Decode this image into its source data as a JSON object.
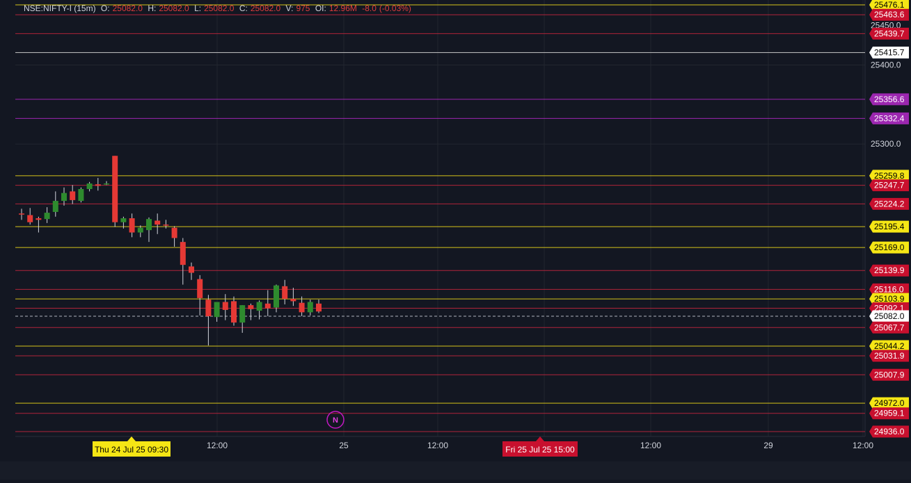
{
  "header": {
    "symbol": "NSE:NIFTY-I (15m)",
    "o_label": "O:",
    "o_val": "25082.0",
    "h_label": "H:",
    "h_val": "25082.0",
    "l_label": "L:",
    "l_val": "25082.0",
    "c_label": "C:",
    "c_val": "25082.0",
    "v_label": "V:",
    "v_val": "975",
    "oi_label": "OI:",
    "oi_val": "12.96M",
    "change": "-8.0",
    "change_pct": "(-0.03%)"
  },
  "colors": {
    "background": "#131722",
    "grid": "#22262f",
    "up": "#26a69a",
    "up_body": "#2e8b2e",
    "down": "#e53935",
    "yellow_line": "#d4c31a",
    "red_line": "#b0243a",
    "purple_line": "#9c27b0",
    "white_line": "#c8c8c8",
    "last_price_line": "#b2b5be",
    "text": "#d1d4dc"
  },
  "chart_data": {
    "type": "candlestick",
    "symbol": "NSE:NIFTY-I",
    "interval": "15m",
    "ylim": [
      24920,
      25480
    ],
    "y_ticks": [
      25300.0,
      25400.0
    ],
    "x_ticks": [
      "12:00",
      "25",
      "12:00",
      "12:00",
      "29",
      "12:00"
    ],
    "candles": [
      {
        "o": 25212,
        "h": 25218,
        "l": 25204,
        "c": 25211
      },
      {
        "o": 25210,
        "h": 25219,
        "l": 25198,
        "c": 25201
      },
      {
        "o": 25206,
        "h": 25208,
        "l": 25188,
        "c": 25204
      },
      {
        "o": 25205,
        "h": 25220,
        "l": 25200,
        "c": 25213
      },
      {
        "o": 25214,
        "h": 25240,
        "l": 25208,
        "c": 25228
      },
      {
        "o": 25228,
        "h": 25245,
        "l": 25222,
        "c": 25238
      },
      {
        "o": 25240,
        "h": 25248,
        "l": 25224,
        "c": 25229
      },
      {
        "o": 25228,
        "h": 25245,
        "l": 25226,
        "c": 25243
      },
      {
        "o": 25243,
        "h": 25252,
        "l": 25240,
        "c": 25250
      },
      {
        "o": 25249,
        "h": 25257,
        "l": 25241,
        "c": 25247
      },
      {
        "o": 25249,
        "h": 25253,
        "l": 25248,
        "c": 25250
      },
      {
        "o": 25285,
        "h": 25285,
        "l": 25195,
        "c": 25201
      },
      {
        "o": 25201,
        "h": 25208,
        "l": 25193,
        "c": 25206
      },
      {
        "o": 25206,
        "h": 25212,
        "l": 25182,
        "c": 25188
      },
      {
        "o": 25188,
        "h": 25197,
        "l": 25182,
        "c": 25194
      },
      {
        "o": 25191,
        "h": 25207,
        "l": 25176,
        "c": 25205
      },
      {
        "o": 25203,
        "h": 25212,
        "l": 25186,
        "c": 25198
      },
      {
        "o": 25198,
        "h": 25204,
        "l": 25193,
        "c": 25197
      },
      {
        "o": 25194,
        "h": 25196,
        "l": 25170,
        "c": 25181
      },
      {
        "o": 25176,
        "h": 25181,
        "l": 25122,
        "c": 25147
      },
      {
        "o": 25145,
        "h": 25150,
        "l": 25128,
        "c": 25137
      },
      {
        "o": 25129,
        "h": 25134,
        "l": 25083,
        "c": 25105
      },
      {
        "o": 25103,
        "h": 25109,
        "l": 25045,
        "c": 25082
      },
      {
        "o": 25081,
        "h": 25097,
        "l": 25075,
        "c": 25100
      },
      {
        "o": 25100,
        "h": 25110,
        "l": 25077,
        "c": 25090
      },
      {
        "o": 25101,
        "h": 25107,
        "l": 25070,
        "c": 25074
      },
      {
        "o": 25074,
        "h": 25096,
        "l": 25061,
        "c": 25096
      },
      {
        "o": 25096,
        "h": 25098,
        "l": 25077,
        "c": 25091
      },
      {
        "o": 25089,
        "h": 25102,
        "l": 25078,
        "c": 25100
      },
      {
        "o": 25098,
        "h": 25115,
        "l": 25082,
        "c": 25092
      },
      {
        "o": 25093,
        "h": 25122,
        "l": 25087,
        "c": 25121
      },
      {
        "o": 25120,
        "h": 25128,
        "l": 25097,
        "c": 25104
      },
      {
        "o": 25104,
        "h": 25118,
        "l": 25095,
        "c": 25101
      },
      {
        "o": 25099,
        "h": 25107,
        "l": 25082,
        "c": 25087
      },
      {
        "o": 25087,
        "h": 25103,
        "l": 25083,
        "c": 25100
      },
      {
        "o": 25098,
        "h": 25103,
        "l": 25086,
        "c": 25088
      }
    ],
    "levels": [
      {
        "price": 25476.1,
        "label": "25476.1",
        "color": "yellow"
      },
      {
        "price": 25463.6,
        "label": "25463.6",
        "color": "red"
      },
      {
        "price": 25439.7,
        "label": "25439.7",
        "color": "red"
      },
      {
        "price": 25415.7,
        "label": "25415.7",
        "color": "white"
      },
      {
        "price": 25356.6,
        "label": "25356.6",
        "color": "purple"
      },
      {
        "price": 25332.4,
        "label": "25332.4",
        "color": "purple"
      },
      {
        "price": 25259.8,
        "label": "25259.8",
        "color": "yellow"
      },
      {
        "price": 25247.7,
        "label": "25247.7",
        "color": "red"
      },
      {
        "price": 25224.2,
        "label": "25224.2",
        "color": "red"
      },
      {
        "price": 25195.4,
        "label": "25195.4",
        "color": "yellow"
      },
      {
        "price": 25169.0,
        "label": "25169.0",
        "color": "yellow"
      },
      {
        "price": 25139.9,
        "label": "25139.9",
        "color": "red"
      },
      {
        "price": 25116.0,
        "label": "25116.0",
        "color": "red"
      },
      {
        "price": 25103.9,
        "label": "25103.9",
        "color": "yellow"
      },
      {
        "price": 25092.1,
        "label": "25092.1",
        "color": "red"
      },
      {
        "price": 25082.0,
        "label": "25082.0",
        "color": "last"
      },
      {
        "price": 25067.7,
        "label": "25067.7",
        "color": "red"
      },
      {
        "price": 25044.2,
        "label": "25044.2",
        "color": "yellow"
      },
      {
        "price": 25031.9,
        "label": "25031.9",
        "color": "red"
      },
      {
        "price": 25007.9,
        "label": "25007.9",
        "color": "red"
      },
      {
        "price": 24972.0,
        "label": "24972.0",
        "color": "yellow"
      },
      {
        "price": 24959.1,
        "label": "24959.1",
        "color": "red"
      },
      {
        "price": 24936.0,
        "label": "24936.0",
        "color": "red"
      }
    ],
    "partial_tick_label": "25450.0",
    "news_marker": "N",
    "time_flags": [
      {
        "label": "Thu 24 Jul 25 09:30",
        "color": "yellow"
      },
      {
        "label": "Fri 25 Jul 25 15:00",
        "color": "red"
      }
    ]
  }
}
